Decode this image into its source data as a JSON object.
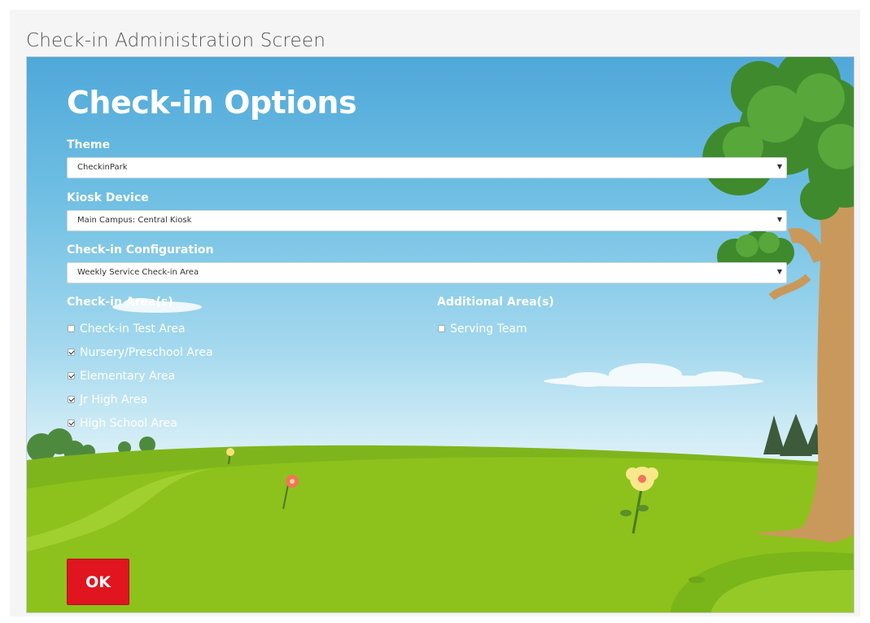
{
  "caption": "Check-in Administration Screen",
  "title": "Check-in Options",
  "theme": {
    "label": "Theme",
    "value": "CheckinPark"
  },
  "kiosk": {
    "label": "Kiosk Device",
    "value": "Main Campus: Central Kiosk"
  },
  "config": {
    "label": "Check-in Configuration",
    "value": "Weekly Service Check-in Area"
  },
  "checkin_areas": {
    "heading": "Check-in Area(s)",
    "items": [
      {
        "label": "Check-in Test Area",
        "checked": false
      },
      {
        "label": "Nursery/Preschool Area",
        "checked": true
      },
      {
        "label": "Elementary Area",
        "checked": true
      },
      {
        "label": "Jr High Area",
        "checked": true
      },
      {
        "label": "High School Area",
        "checked": true
      }
    ]
  },
  "additional_areas": {
    "heading": "Additional Area(s)",
    "items": [
      {
        "label": "Serving Team",
        "checked": false
      }
    ]
  },
  "ok_label": "OK",
  "colors": {
    "ok_button": "#e0151f",
    "sky_top": "#4fa8d9",
    "grass": "#8cc21b"
  },
  "select_caret_icon": "caret-down-icon"
}
